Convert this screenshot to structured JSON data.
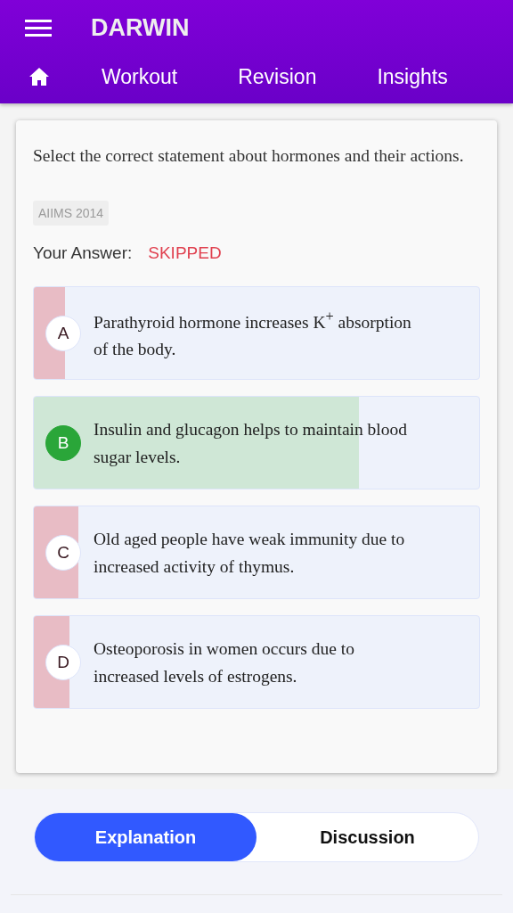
{
  "app_bar": {
    "title": "DARWIN"
  },
  "tabs": [
    {
      "label": "Workout",
      "selected": false
    },
    {
      "label": "Revision",
      "selected": false
    },
    {
      "label": "Insights",
      "selected": false
    }
  ],
  "question": {
    "text": "Select the correct statement about hormones and their actions.",
    "source": "AIIMS 2014",
    "answer_label": "Your Answer:",
    "answer_value": "SKIPPED"
  },
  "options": [
    {
      "letter": "A",
      "text": "Parathyroid hormone increases K$^{+}$ absorption of the body.",
      "level": 0.07,
      "correct": false
    },
    {
      "letter": "B",
      "text": "Insulin and glucagon helps to maintain blood sugar levels.",
      "level": 0.73,
      "correct": true
    },
    {
      "letter": "C",
      "text": "Old aged people have weak immunity due to increased activity of thymus.",
      "level": 0.1,
      "correct": false
    },
    {
      "letter": "D",
      "text": "Osteoporosis in women occurs due to increased levels of estrogens.",
      "level": 0.08,
      "correct": false
    }
  ],
  "segments": [
    {
      "label": "Explanation",
      "selected": true
    },
    {
      "label": "Discussion",
      "selected": false
    }
  ]
}
